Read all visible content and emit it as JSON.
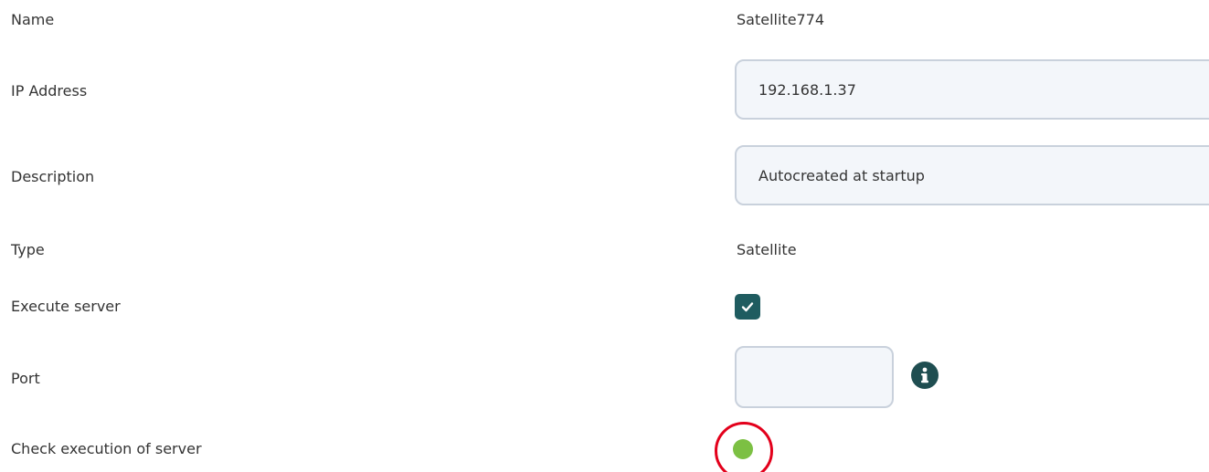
{
  "form": {
    "name": {
      "label": "Name",
      "value": "Satellite774"
    },
    "ip_address": {
      "label": "IP Address",
      "value": "192.168.1.37"
    },
    "description": {
      "label": "Description",
      "value": "Autocreated at startup"
    },
    "type": {
      "label": "Type",
      "value": "Satellite"
    },
    "execute_server": {
      "label": "Execute server",
      "checked": true
    },
    "port": {
      "label": "Port",
      "value": "",
      "info_icon": "info-icon"
    },
    "check_execution": {
      "label": "Check execution of server",
      "status_color": "#7cc043",
      "highlight_color": "#e3001b"
    }
  },
  "colors": {
    "accent": "#1f5c60",
    "input_bg": "#f3f6fa",
    "input_border": "#c9d1dc",
    "status_ok": "#7cc043",
    "highlight": "#e3001b"
  }
}
